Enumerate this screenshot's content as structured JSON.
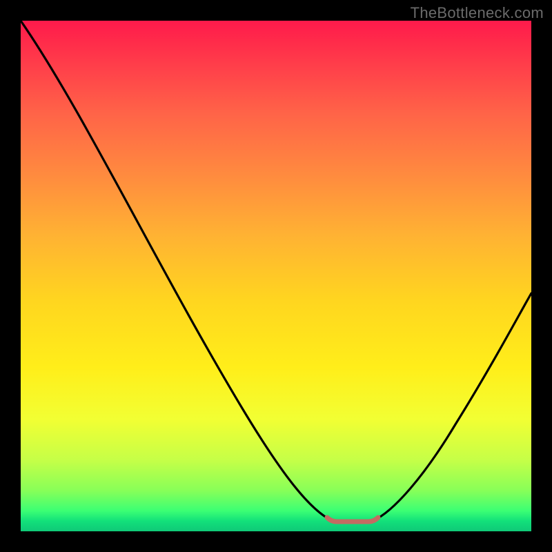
{
  "watermark": "TheBottleneck.com",
  "colors": {
    "background": "#000000",
    "gradient_top": "#ff1a4b",
    "gradient_bottom": "#0fc978",
    "curve": "#000000",
    "flat_segment": "#c46b62",
    "watermark": "#6b6b6b"
  },
  "chart_data": {
    "type": "line",
    "title": "",
    "xlabel": "",
    "ylabel": "",
    "x": [
      0.0,
      0.05,
      0.1,
      0.15,
      0.2,
      0.25,
      0.3,
      0.35,
      0.4,
      0.45,
      0.5,
      0.55,
      0.6,
      0.62,
      0.68,
      0.7,
      0.75,
      0.8,
      0.85,
      0.9,
      0.95,
      1.0
    ],
    "values": [
      1.0,
      0.91,
      0.82,
      0.73,
      0.64,
      0.55,
      0.47,
      0.38,
      0.3,
      0.22,
      0.15,
      0.09,
      0.04,
      0.02,
      0.02,
      0.04,
      0.09,
      0.16,
      0.24,
      0.33,
      0.43,
      0.54
    ],
    "notes": "Axes unlabeled; y interpreted as normalized 0–1 (top=1, bottom=0). Curve shows a V-shaped dip whose minimum sits around x≈0.62–0.68 with a short flat bottom near y≈0.02, rising again toward the right. Background is a vertical red→yellow→green gradient.",
    "xlim": [
      0,
      1
    ],
    "ylim": [
      0,
      1
    ],
    "flat_segment_x": [
      0.6,
      0.7
    ],
    "flat_segment_y": 0.02
  }
}
